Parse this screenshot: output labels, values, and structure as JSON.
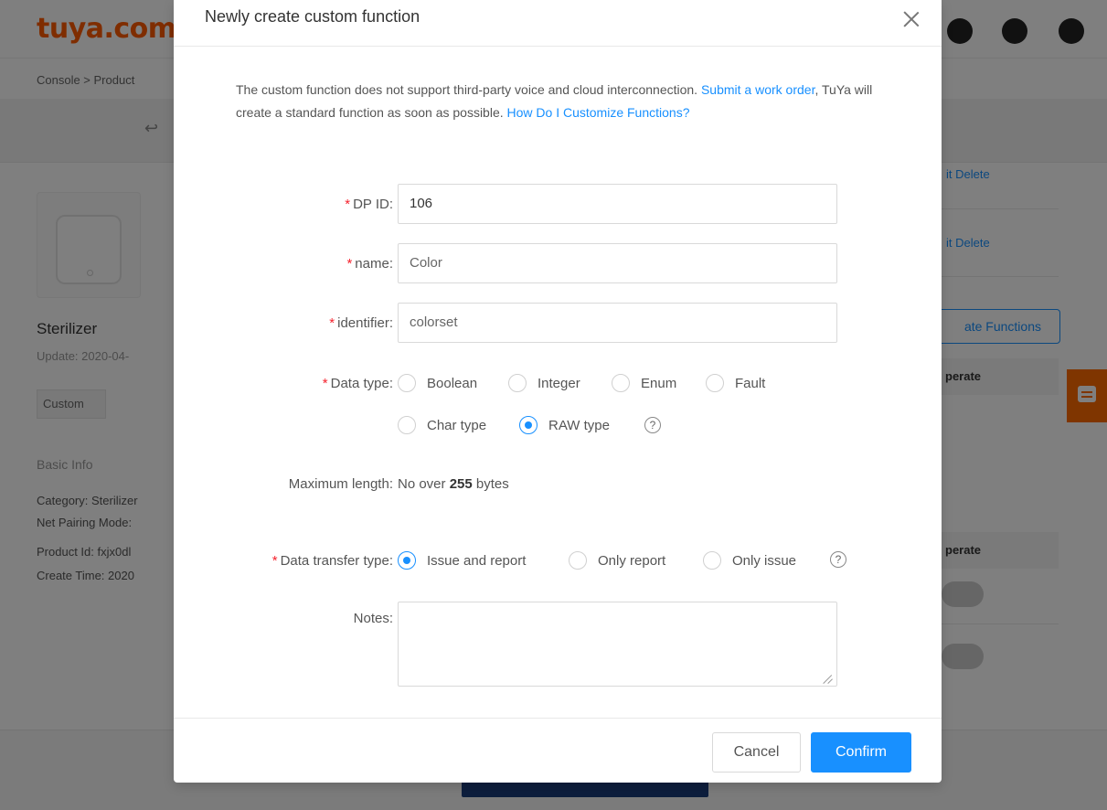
{
  "background": {
    "logo": "tuya.com",
    "breadcrumb": "Console  >  Product",
    "product": {
      "name": "Sterilizer",
      "update": "Update: 2020-04-",
      "tag": "Custom"
    },
    "basic_info": {
      "title": "Basic Info",
      "category": "Category: Sterilizer",
      "net_pairing": "Net Pairing Mode:",
      "product_id": "Product Id: fxjx0dl",
      "create_time": "Create Time: 2020"
    },
    "right": {
      "row1_links": "it  Delete",
      "row2_links": "it  Delete",
      "create_button": "ate Functions",
      "header1": "perate",
      "header2": "perate"
    }
  },
  "modal": {
    "title": "Newly create custom function",
    "notice": {
      "text1": "The custom function does not support third-party voice and cloud interconnection. ",
      "link1": "Submit a work order",
      "text2": ", TuYa will create a standard function as soon as possible. ",
      "link2": "How Do I Customize Functions?"
    },
    "fields": {
      "dp_id": {
        "label": "DP ID:",
        "value": "106"
      },
      "name": {
        "label": "name:",
        "value": "Color"
      },
      "identifier": {
        "label": "identifier:",
        "value": "colorset"
      },
      "data_type": {
        "label": "Data type:",
        "options": [
          "Boolean",
          "Integer",
          "Enum",
          "Fault",
          "Char type",
          "RAW type"
        ],
        "selected": "RAW type"
      },
      "max_length": {
        "label": "Maximum length:",
        "prefix": "No over ",
        "value": "255",
        "suffix": " bytes"
      },
      "transfer_type": {
        "label": "Data transfer type:",
        "options": [
          "Issue and report",
          "Only report",
          "Only issue"
        ],
        "selected": "Issue and report"
      },
      "notes": {
        "label": "Notes:",
        "value": ""
      }
    },
    "help_glyph": "?",
    "buttons": {
      "cancel": "Cancel",
      "confirm": "Confirm"
    }
  },
  "colors": {
    "accent": "#1890ff",
    "required": "#f5222d",
    "brand": "#ff6a00"
  }
}
